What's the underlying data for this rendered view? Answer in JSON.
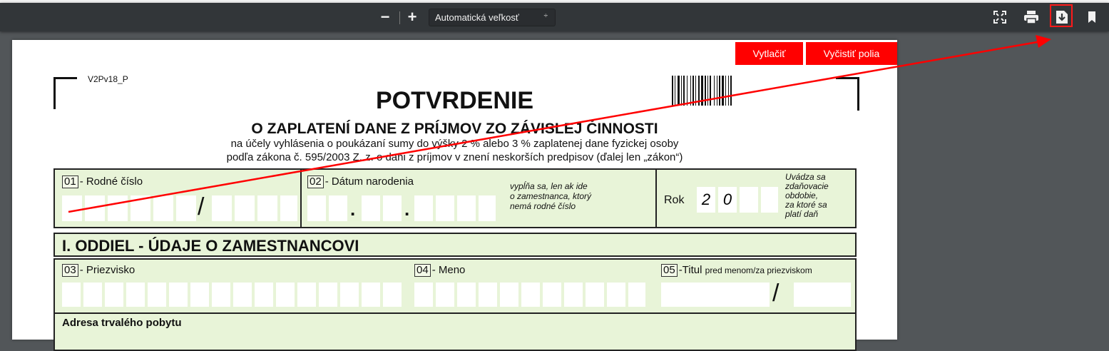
{
  "toolbar": {
    "zoom_out": "−",
    "zoom_in": "+",
    "zoom_value": "Automatická veľkosť",
    "zoom_arrow": "÷",
    "icons": {
      "fit": "fit-page-icon",
      "print": "print-icon",
      "download": "download-icon",
      "bookmark": "bookmark-icon"
    }
  },
  "form_buttons": {
    "print": "Vytlačiť",
    "clear": "Vyčistiť polia"
  },
  "form": {
    "code": "V2Pv18_P",
    "title": "POTVRDENIE",
    "subtitle": "O ZAPLATENÍ DANE Z PRÍJMOV ZO ZÁVISLEJ ČINNOSTI",
    "desc1": "na účely vyhlásenia o poukázaní sumy do výšky 2 % alebo 3 % zaplatenej dane fyzickej osoby",
    "desc2": "podľa zákona č. 595/2003 Z. z. o dani z príjmov v znení neskorších predpisov (ďalej len „zákon“)",
    "field01_num": "01",
    "field01_label": "- Rodné číslo",
    "field02_num": "02",
    "field02_label": "- Dátum narodenia",
    "field02_note": [
      "vypĺňa sa, len ak ide",
      "o zamestnanca, ktorý",
      "nemá rodné číslo"
    ],
    "rok_label": "Rok",
    "rok_digits": [
      "2",
      "0"
    ],
    "period_note": [
      "Uvádza sa",
      "zdaňovacie",
      "obdobie,",
      "za ktoré sa",
      "platí daň"
    ],
    "section1_title": "I. ODDIEL - ÚDAJE O ZAMESTNANCOVI",
    "field03_num": "03",
    "field03_label": "- Priezvisko",
    "field04_num": "04",
    "field04_label": "- Meno",
    "field05_num": "05",
    "field05_label": "-Titul",
    "field05_before": "pred menom",
    "field05_slash": "/",
    "field05_after": "za priezviskom",
    "address_label": "Adresa trvalého pobytu",
    "slash": "/",
    "dot": "."
  },
  "colors": {
    "toolbar": "#323639",
    "viewer_bg": "#525659",
    "form_green": "#e8f4d8",
    "accent_red": "#ff0000"
  }
}
